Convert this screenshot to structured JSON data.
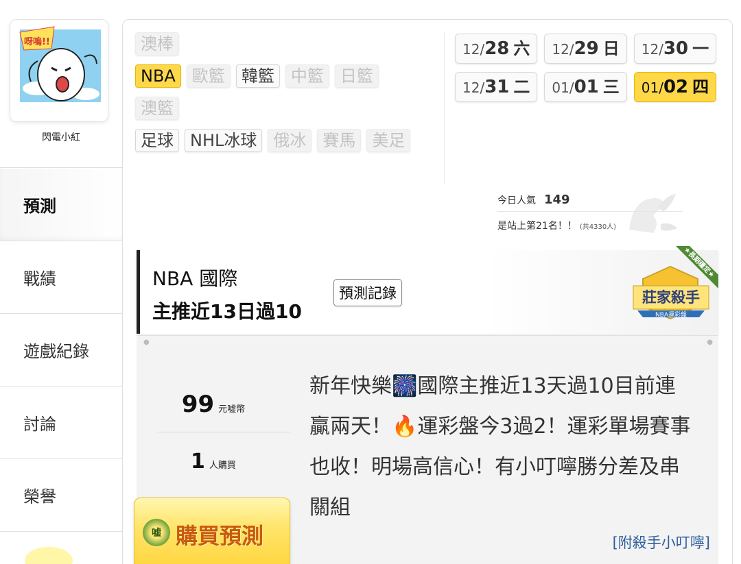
{
  "profile": {
    "username": "閃電小紅",
    "avatar_icon": "cartoon-egg-avatar-icon",
    "avatar_bubble": "呀嗚!!"
  },
  "nav": {
    "items": [
      {
        "label": "預測",
        "active": true
      },
      {
        "label": "戰績",
        "active": false
      },
      {
        "label": "遊戲紀錄",
        "active": false
      },
      {
        "label": "討論",
        "active": false
      },
      {
        "label": "榮譽",
        "active": false
      }
    ]
  },
  "sport_tabs": {
    "rows": [
      [
        {
          "label": "澳棒",
          "state": "disabled"
        }
      ],
      [
        {
          "label": "NBA",
          "state": "active"
        },
        {
          "label": "歐籃",
          "state": "disabled"
        },
        {
          "label": "韓籃",
          "state": "normal"
        },
        {
          "label": "中籃",
          "state": "disabled"
        },
        {
          "label": "日籃",
          "state": "disabled"
        }
      ],
      [
        {
          "label": "澳籃",
          "state": "disabled"
        }
      ],
      [
        {
          "label": "足球",
          "state": "normal"
        },
        {
          "label": "NHL冰球",
          "state": "normal"
        },
        {
          "label": "俄冰",
          "state": "disabled"
        },
        {
          "label": "賽馬",
          "state": "disabled"
        },
        {
          "label": "美足",
          "state": "disabled"
        }
      ]
    ]
  },
  "date_tabs": {
    "rows": [
      [
        {
          "month": "12/",
          "day": "28",
          "weekday": "六",
          "active": false
        },
        {
          "month": "12/",
          "day": "29",
          "weekday": "日",
          "active": false
        },
        {
          "month": "12/",
          "day": "30",
          "weekday": "一",
          "active": false
        }
      ],
      [
        {
          "month": "12/",
          "day": "31",
          "weekday": "二",
          "active": false
        },
        {
          "month": "01/",
          "day": "01",
          "weekday": "三",
          "active": false
        },
        {
          "month": "01/",
          "day": "02",
          "weekday": "四",
          "active": true
        }
      ]
    ]
  },
  "stats": {
    "popularity_label": "今日人氣",
    "popularity_value": "149",
    "rank_text": "是站上第21名！！",
    "rank_total": "(共4330人)"
  },
  "predictor": {
    "league": "NBA 國際",
    "record": "主推近13日過10",
    "history_button": "預測記錄",
    "badge_title": "莊家殺手",
    "badge_sub": "NBA運彩盤",
    "badge_ribbon": "★長期穩定★"
  },
  "listing": {
    "price_value": "99",
    "price_unit": "元嘘幣",
    "buyers_value": "1",
    "buyers_unit": "人購買",
    "buy_button": "購買預測",
    "buy_coin": "嘘",
    "description": "新年快樂🎆國際主推近13天過10目前連贏兩天！🔥運彩盤今3過2！運彩單場賽事也收！明場高信心！有小叮嚀勝分差及串關組",
    "attachment": "[附殺手小叮嚀]"
  },
  "colors": {
    "accent_yellow": "#ffd84a",
    "buy_text": "#c85a10",
    "link_blue": "#2c5d9e"
  }
}
